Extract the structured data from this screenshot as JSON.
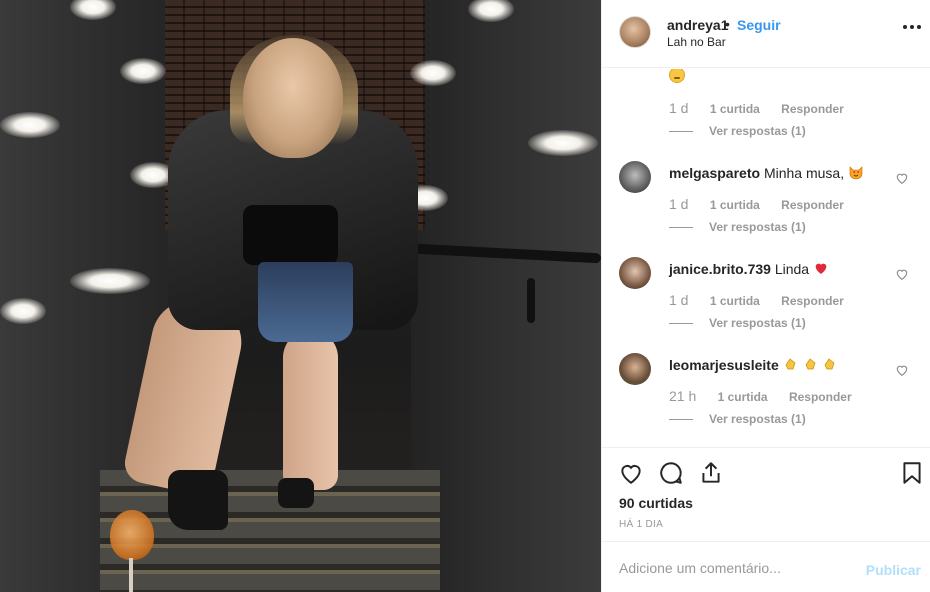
{
  "post": {
    "username": "andreya1",
    "separator": "•",
    "follow_label": "Seguir",
    "location": "Lah no Bar",
    "more_icon": "more-options-icon"
  },
  "comments": [
    {
      "username": "",
      "text": "",
      "emoji": "grinning-face-icon",
      "time": "1 d",
      "likes": "1 curtida",
      "reply": "Responder",
      "view_replies": "Ver respostas (1)"
    },
    {
      "username": "melgaspareto",
      "text": "Minha musa,",
      "emoji": "heart-eyes-cat-icon",
      "time": "1 d",
      "likes": "1 curtida",
      "reply": "Responder",
      "view_replies": "Ver respostas (1)"
    },
    {
      "username": "janice.brito.739",
      "text": "Linda",
      "emoji": "red-heart-icon",
      "time": "1 d",
      "likes": "1 curtida",
      "reply": "Responder",
      "view_replies": "Ver respostas (1)"
    },
    {
      "username": "leomarjesusleite",
      "text": "",
      "emoji": "clapping-hands-icon",
      "time": "21 h",
      "likes": "1 curtida",
      "reply": "Responder",
      "view_replies": "Ver respostas (1)"
    }
  ],
  "actions": {
    "like_icon": "heart-icon",
    "comment_icon": "comment-icon",
    "share_icon": "share-icon",
    "save_icon": "bookmark-icon",
    "likes_count": "90 curtidas",
    "date": "HÁ 1 DIA"
  },
  "add_comment": {
    "placeholder": "Adicione um comentário...",
    "publish_label": "Publicar"
  },
  "colors": {
    "link_blue": "#3897f0",
    "muted": "#999999",
    "publish_disabled": "#b2dffc",
    "heart_red": "#ed4956"
  }
}
